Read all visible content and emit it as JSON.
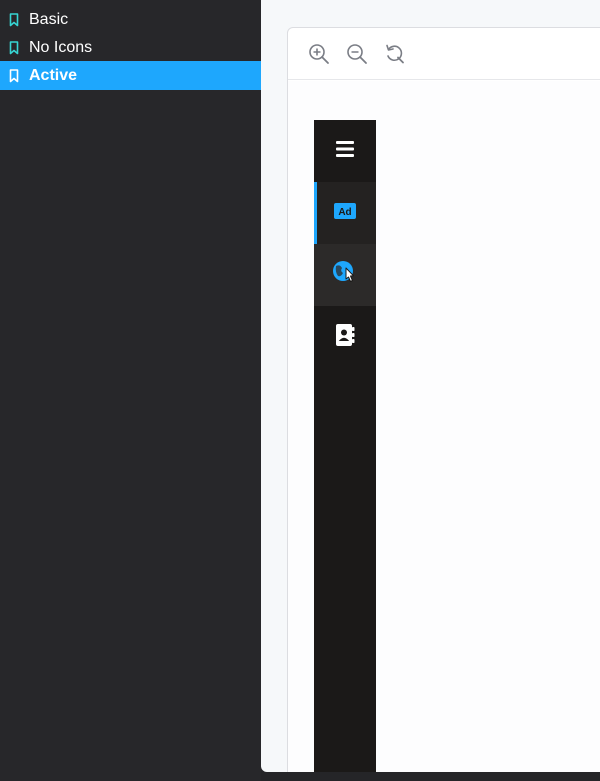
{
  "sidebar": {
    "items": [
      {
        "label": "Basic",
        "active": false
      },
      {
        "label": "No Icons",
        "active": false
      },
      {
        "label": "Active",
        "active": true
      }
    ]
  },
  "toolbar": {
    "buttons": [
      {
        "icon": "zoom-in-icon"
      },
      {
        "icon": "zoom-out-icon"
      },
      {
        "icon": "reset-zoom-icon"
      }
    ]
  },
  "nav_rail": {
    "items": [
      {
        "icon": "menu-icon",
        "active": false
      },
      {
        "icon": "ad-icon",
        "active": true
      },
      {
        "icon": "globe-icon",
        "active": false,
        "hovered": true
      },
      {
        "icon": "contact-book-icon",
        "active": false
      }
    ]
  },
  "colors": {
    "accent": "#1ea7fd",
    "bookmark": "#37d5d3",
    "sidebar_bg": "#27272a",
    "rail_bg": "#1b1918"
  }
}
